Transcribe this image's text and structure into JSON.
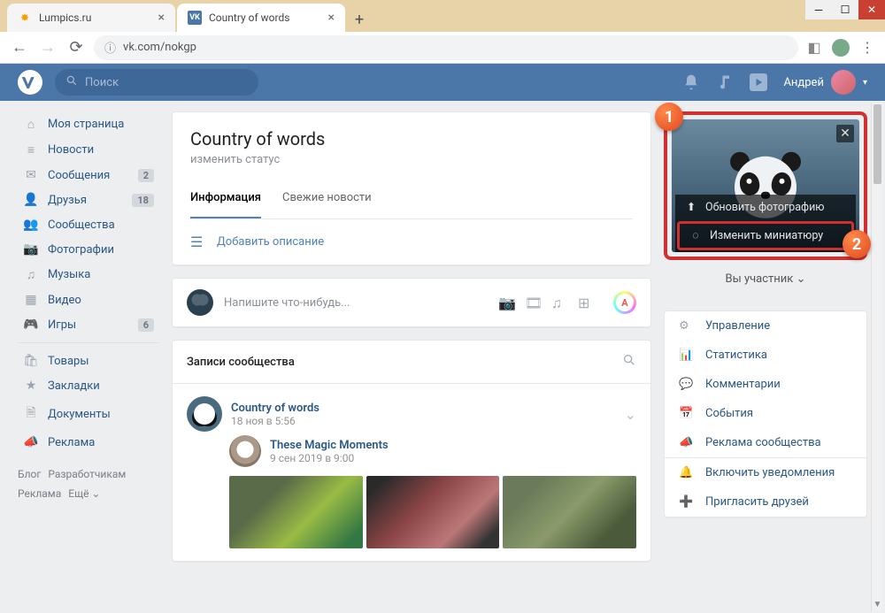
{
  "browser": {
    "tabs": [
      {
        "title": "Lumpics.ru"
      },
      {
        "title": "Country of words"
      }
    ],
    "url": "vk.com/nokgp"
  },
  "vk_header": {
    "logo": "VK",
    "search_placeholder": "Поиск",
    "user_name": "Андрей"
  },
  "sidebar": {
    "items": [
      {
        "icon": "home",
        "label": "Моя страница",
        "badge": ""
      },
      {
        "icon": "feed",
        "label": "Новости",
        "badge": ""
      },
      {
        "icon": "msg",
        "label": "Сообщения",
        "badge": "2"
      },
      {
        "icon": "friends",
        "label": "Друзья",
        "badge": "18"
      },
      {
        "icon": "groups",
        "label": "Сообщества",
        "badge": ""
      },
      {
        "icon": "photo",
        "label": "Фотографии",
        "badge": ""
      },
      {
        "icon": "music",
        "label": "Музыка",
        "badge": ""
      },
      {
        "icon": "video",
        "label": "Видео",
        "badge": ""
      },
      {
        "icon": "games",
        "label": "Игры",
        "badge": "6"
      }
    ],
    "items2": [
      {
        "icon": "market",
        "label": "Товары"
      },
      {
        "icon": "bookmark",
        "label": "Закладки"
      },
      {
        "icon": "docs",
        "label": "Документы"
      },
      {
        "icon": "ads",
        "label": "Реклама"
      }
    ],
    "footer": {
      "blog": "Блог",
      "devs": "Разработчикам",
      "ads": "Реклама",
      "more": "Ещё"
    }
  },
  "profile": {
    "title": "Country of words",
    "status": "изменить статус",
    "tab_info": "Информация",
    "tab_news": "Свежие новости",
    "add_desc": "Добавить описание"
  },
  "compose": {
    "placeholder": "Напишите что-нибудь..."
  },
  "wall": {
    "header": "Записи сообщества",
    "post_name": "Country of words",
    "post_date": "18 ноя в 5:56",
    "repost_name": "These Magic Moments",
    "repost_date": "9 сен 2019 в 9:00"
  },
  "cover": {
    "update_photo": "Обновить фотографию",
    "change_thumb": "Изменить миниатюру",
    "member_status": "Вы участник"
  },
  "admin": {
    "manage": "Управление",
    "stats": "Статистика",
    "comments": "Комментарии",
    "events": "События",
    "ads": "Реклама сообщества",
    "notify": "Включить уведомления",
    "invite": "Пригласить друзей"
  },
  "callouts": {
    "one": "1",
    "two": "2"
  }
}
